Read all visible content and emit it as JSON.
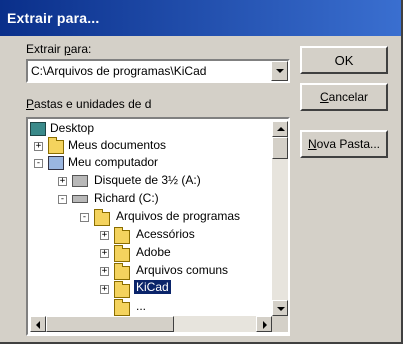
{
  "window": {
    "title": "Extrair para..."
  },
  "path_label": {
    "pre": "Extrair ",
    "underlined": "p",
    "post": "ara:"
  },
  "path_value": "C:\\Arquivos de programas\\KiCad",
  "folders_label": {
    "underlined": "P",
    "post": "astas e unidades de d"
  },
  "buttons": {
    "ok": "OK",
    "cancel": {
      "underlined": "C",
      "post": "ancelar"
    },
    "new_folder": {
      "underlined": "N",
      "post": "ova Pasta..."
    }
  },
  "tree": [
    {
      "label": "Desktop",
      "icon": "desktop-icon",
      "expander": ""
    },
    {
      "label": "Meus documentos",
      "icon": "documents-folder-icon",
      "expander": "+"
    },
    {
      "label": "Meu computador",
      "icon": "computer-icon",
      "expander": "-"
    },
    {
      "label": "Disquete de 3½ (A:)",
      "icon": "floppy-drive-icon",
      "expander": "+"
    },
    {
      "label": "Richard (C:)",
      "icon": "hard-drive-icon",
      "expander": "-"
    },
    {
      "label": "Arquivos de programas",
      "icon": "open-folder-icon",
      "expander": "-"
    },
    {
      "label": "Acessórios",
      "icon": "folder-icon",
      "expander": "+"
    },
    {
      "label": "Adobe",
      "icon": "folder-icon",
      "expander": "+"
    },
    {
      "label": "Arquivos comuns",
      "icon": "folder-icon",
      "expander": "+"
    },
    {
      "label": "KiCad",
      "icon": "open-folder-icon",
      "expander": "+",
      "selected": true
    },
    {
      "label": "...",
      "icon": "folder-icon",
      "expander": ""
    }
  ],
  "colors": {
    "selection": "#0a246a",
    "title_bar": "#0a2f8a",
    "folder": "#f4d35e"
  }
}
